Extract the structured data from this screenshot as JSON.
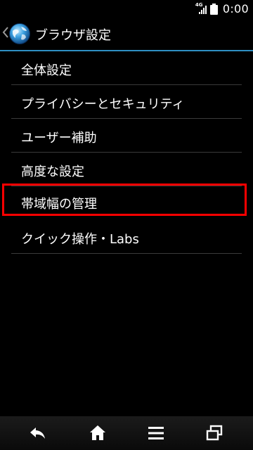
{
  "status_bar": {
    "network_type": "4G",
    "time": "0:00"
  },
  "action_bar": {
    "title": "ブラウザ設定"
  },
  "settings_items": [
    {
      "label": "全体設定"
    },
    {
      "label": "プライバシーとセキュリティ"
    },
    {
      "label": "ユーザー補助"
    },
    {
      "label": "高度な設定"
    },
    {
      "label": "帯域幅の管理",
      "highlighted": true,
      "highlight_color": "#ff0000"
    },
    {
      "label": "クイック操作・Labs"
    }
  ],
  "colors": {
    "background": "#000000",
    "accent_divider": "#2f8fc3",
    "highlight_frame": "#ff0000"
  },
  "nav_bar": {
    "icons": [
      "back-icon",
      "home-icon",
      "menu-icon",
      "recent-apps-icon"
    ]
  }
}
